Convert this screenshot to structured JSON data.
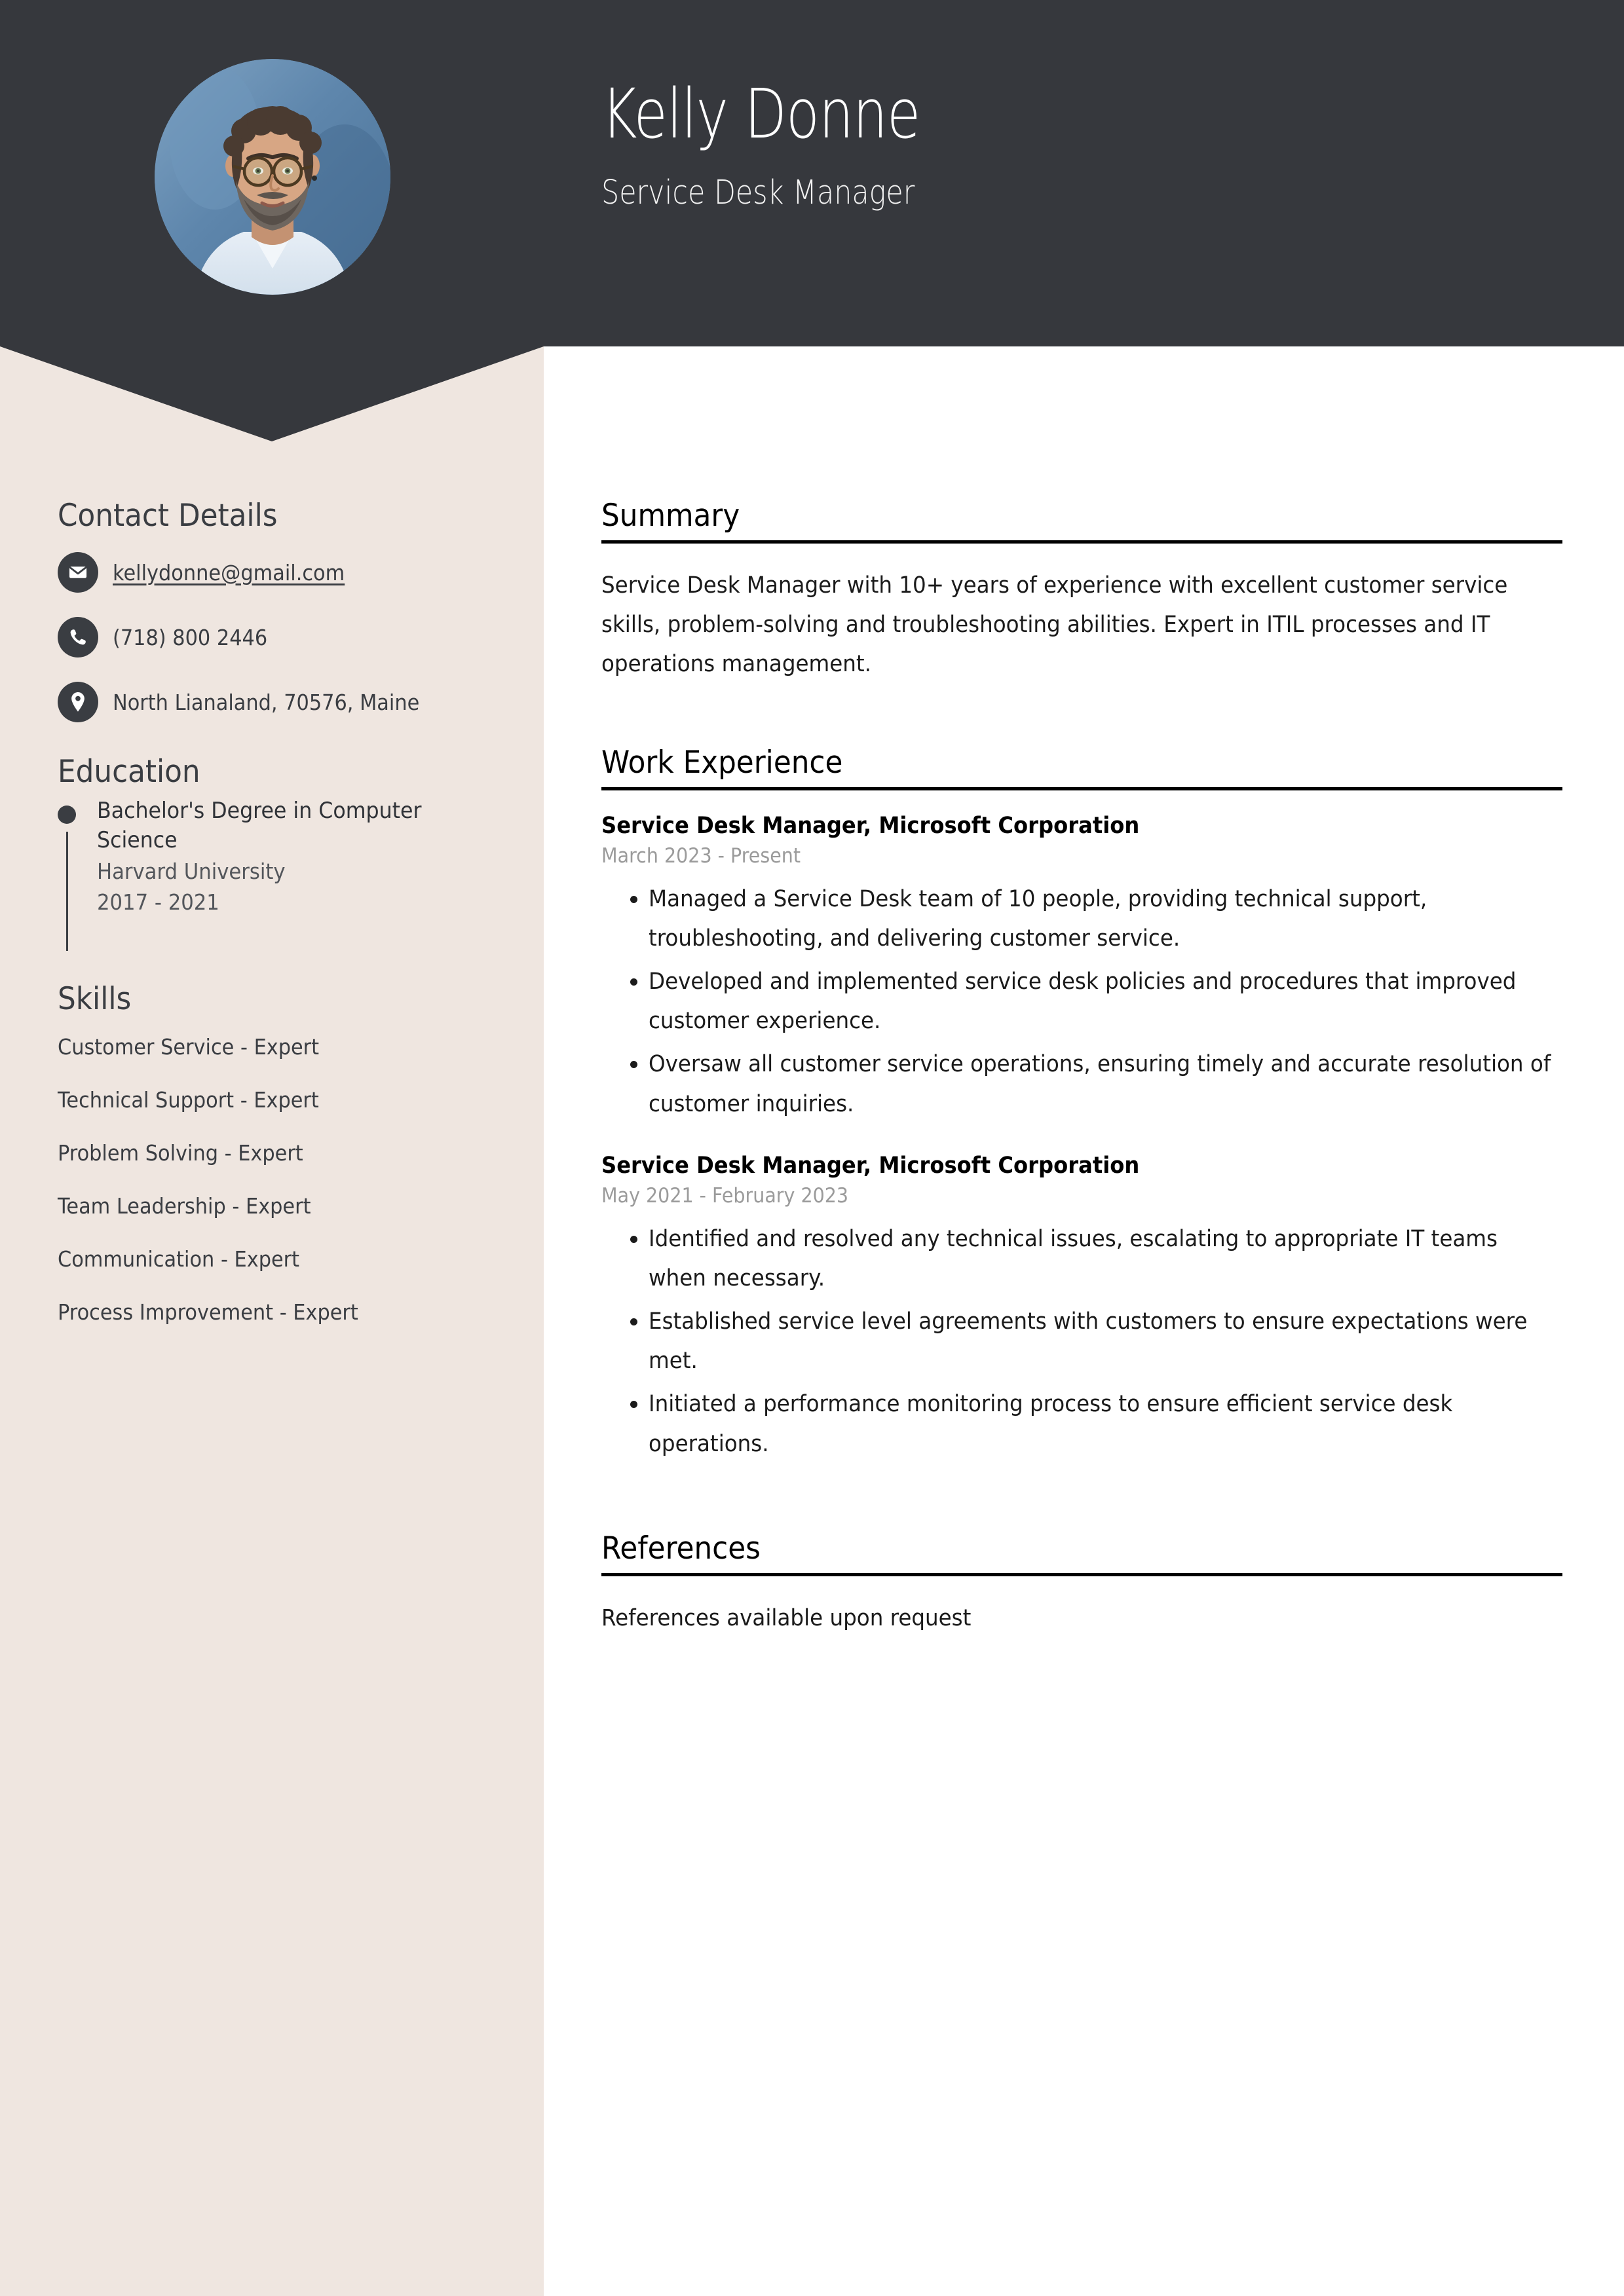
{
  "theme": {
    "header_bg": "#36383D",
    "sidebar_bg": "#EFE6E0",
    "page_bg": "#ffffff",
    "heading_color": "#3A3D42",
    "date_color": "#9B9B9B",
    "rule_color": "#000000"
  },
  "header": {
    "name": "Kelly Donne",
    "job_title": "Service Desk Manager",
    "avatar_alt": "profile-photo"
  },
  "sidebar": {
    "contact": {
      "heading": "Contact Details",
      "items": [
        {
          "icon": "envelope-icon",
          "text": "kellydonne@gmail.com",
          "type": "email"
        },
        {
          "icon": "phone-icon",
          "text": "(718) 800 2446",
          "type": "phone"
        },
        {
          "icon": "map-pin-icon",
          "text": "North Lianaland, 70576, Maine",
          "type": "address"
        }
      ]
    },
    "education": {
      "heading": "Education",
      "items": [
        {
          "degree": "Bachelor's Degree in Computer Science",
          "school": "Harvard University",
          "years": "2017 - 2021"
        }
      ]
    },
    "skills": {
      "heading": "Skills",
      "items": [
        "Customer Service - Expert",
        "Technical Support - Expert",
        "Problem Solving - Expert",
        "Team Leadership - Expert",
        "Communication - Expert",
        "Process Improvement - Expert"
      ]
    }
  },
  "main": {
    "summary": {
      "heading": "Summary",
      "text": "Service Desk Manager with 10+ years of experience with excellent customer service skills, problem-solving and troubleshooting abilities. Expert in ITIL processes and IT operations management."
    },
    "work_experience": {
      "heading": "Work Experience",
      "jobs": [
        {
          "title": "Service Desk Manager, Microsoft Corporation",
          "dates": "March 2023 - Present",
          "bullets": [
            "Managed a Service Desk team of 10 people, providing technical support, troubleshooting, and delivering customer service.",
            "Developed and implemented service desk policies and procedures that improved customer experience.",
            "Oversaw all customer service operations, ensuring timely and accurate resolution of customer inquiries."
          ]
        },
        {
          "title": "Service Desk Manager, Microsoft Corporation",
          "dates": "May 2021 - February 2023",
          "bullets": [
            "Identified and resolved any technical issues, escalating to appropriate IT teams when necessary.",
            "Established service level agreements with customers to ensure expectations were met.",
            "Initiated a performance monitoring process to ensure efficient service desk operations."
          ]
        }
      ]
    },
    "references": {
      "heading": "References",
      "text": "References available upon request"
    }
  }
}
